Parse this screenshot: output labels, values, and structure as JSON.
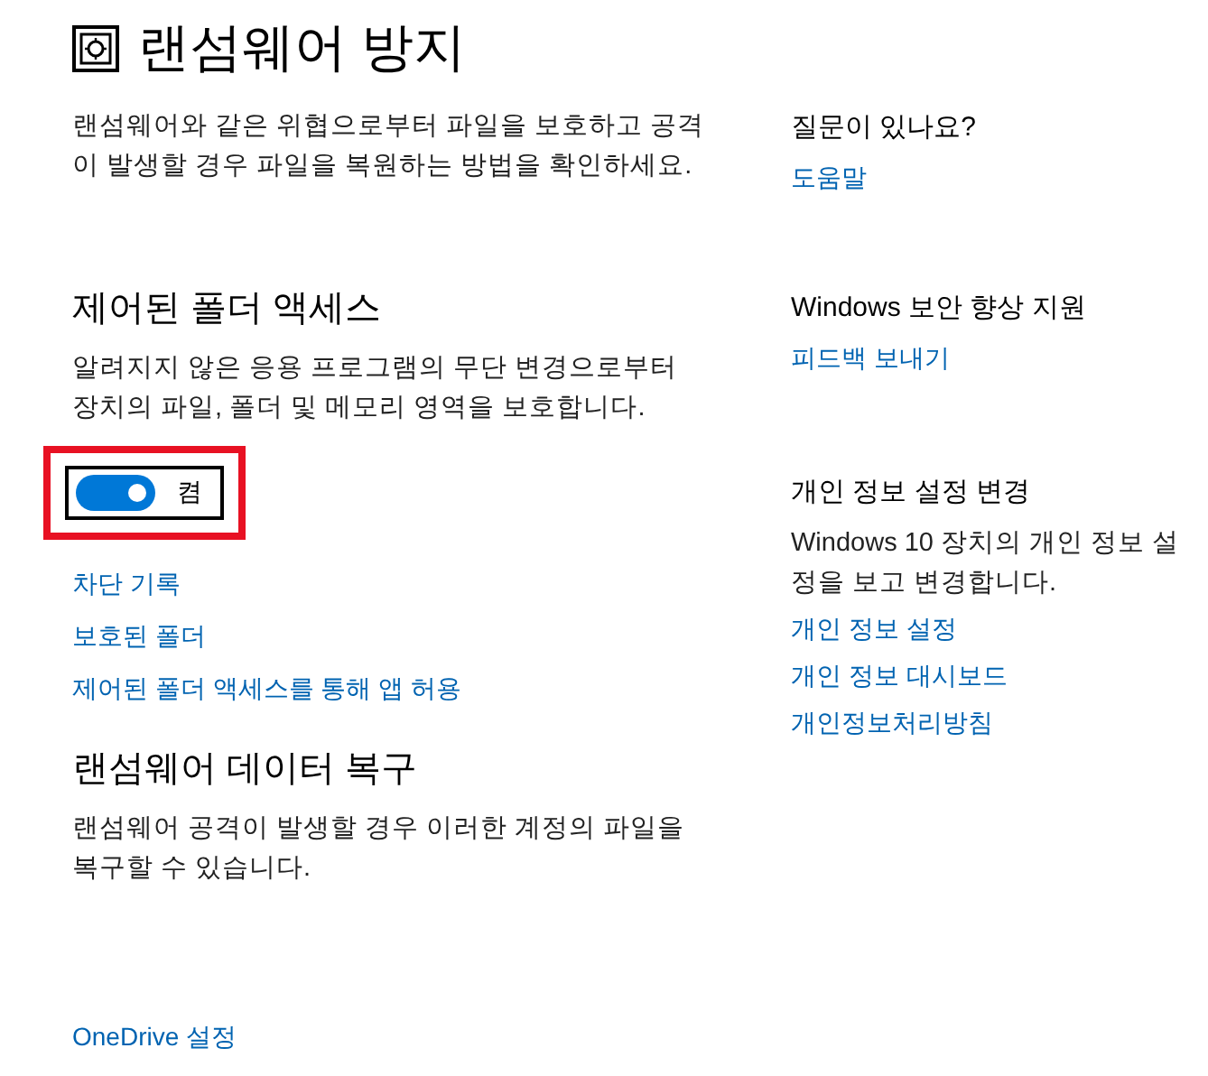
{
  "page": {
    "title": "랜섬웨어 방지",
    "description": "랜섬웨어와 같은 위협으로부터 파일을 보호하고 공격이 발생할 경우 파일을 복원하는 방법을 확인하세요."
  },
  "controlled_folder_access": {
    "heading": "제어된 폴더 액세스",
    "description": "알려지지 않은 응용 프로그램의 무단 변경으로부터 장치의 파일, 폴더 및 메모리 영역을 보호합니다.",
    "toggle": {
      "label": "켬",
      "on": true,
      "highlighted": true
    },
    "links": [
      "차단 기록",
      "보호된 폴더",
      "제어된 폴더 액세스를 통해 앱 허용"
    ]
  },
  "recovery": {
    "heading": "랜섬웨어 데이터 복구",
    "description": "랜섬웨어 공격이 발생할 경우 이러한 계정의 파일을 복구할 수 있습니다.",
    "link": "OneDrive 설정"
  },
  "sidebar": [
    {
      "heading": "질문이 있나요?",
      "links": [
        "도움말"
      ]
    },
    {
      "heading": "Windows 보안 향상 지원",
      "links": [
        "피드백 보내기"
      ]
    },
    {
      "heading": "개인 정보 설정 변경",
      "text": "Windows 10 장치의 개인 정보 설정을 보고 변경합니다.",
      "links": [
        "개인 정보 설정",
        "개인 정보 대시보드",
        "개인정보처리방침"
      ]
    }
  ]
}
